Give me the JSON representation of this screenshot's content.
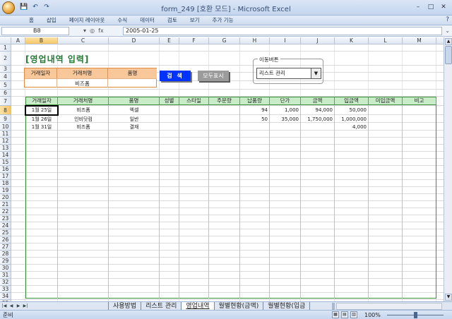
{
  "window": {
    "title": "form_249 [호환 모드] - Microsoft Excel"
  },
  "qat": {
    "save_icon": "💾",
    "undo_icon": "↶",
    "redo_icon": "↷"
  },
  "ribbon_tabs": [
    "홈",
    "삽입",
    "페이지 레이아웃",
    "수식",
    "데이터",
    "검토",
    "보기",
    "추가 기능"
  ],
  "formula_bar": {
    "name_box": "B8",
    "fx": "fx",
    "value": "2005-01-25"
  },
  "columns": [
    "A",
    "B",
    "C",
    "D",
    "E",
    "F",
    "G",
    "H",
    "I",
    "J",
    "K",
    "L",
    "M",
    "N"
  ],
  "rows": [
    "1",
    "2",
    "3",
    "4",
    "5",
    "6",
    "7",
    "8",
    "9",
    "10",
    "11",
    "12",
    "13",
    "14",
    "15",
    "16",
    "17",
    "18",
    "19",
    "20",
    "21",
    "22",
    "23",
    "24",
    "25",
    "26",
    "27",
    "28",
    "29",
    "30",
    "31",
    "32",
    "33",
    "34",
    "35"
  ],
  "sheet": {
    "title": "[영업내역 입력]",
    "search": {
      "headers": [
        "거래일자",
        "거래처명",
        "품명"
      ],
      "values": [
        "",
        "비즈폼",
        ""
      ]
    },
    "search_button": "검 색",
    "show_all_button": "모두표시",
    "nav_group": {
      "label": "이동버튼",
      "selected": "리스트 관리"
    },
    "table": {
      "headers": [
        "거래일자",
        "거래처명",
        "품명",
        "성별",
        "스타일",
        "주문량",
        "납품량",
        "단가",
        "금액",
        "입금액",
        "미입금액",
        "비고"
      ],
      "rows": [
        [
          "1월 25일",
          "비즈폼",
          "엑셀",
          "",
          "",
          "",
          "94",
          "1,000",
          "94,000",
          "50,000",
          "",
          ""
        ],
        [
          "1월 26일",
          "인비닷컴",
          "일반",
          "",
          "",
          "",
          "50",
          "35,000",
          "1,750,000",
          "1,000,000",
          "",
          ""
        ],
        [
          "1월 31일",
          "비즈폼",
          "결재",
          "",
          "",
          "",
          "",
          "",
          "",
          "4,000",
          "",
          ""
        ]
      ]
    }
  },
  "sheet_tabs": [
    "사용방법",
    "리스트 관리",
    "영업내역",
    "월별현황(금액)",
    "월별현황(입금"
  ],
  "active_tab_index": 2,
  "status": {
    "ready": "준비",
    "zoom": "100%"
  },
  "colors": {
    "header_green": "#c8ebc8",
    "border_green": "#3b8f3b",
    "search_orange": "#f8c79a",
    "search_btn": "#0033ff",
    "title_green": "#1f7a30"
  }
}
